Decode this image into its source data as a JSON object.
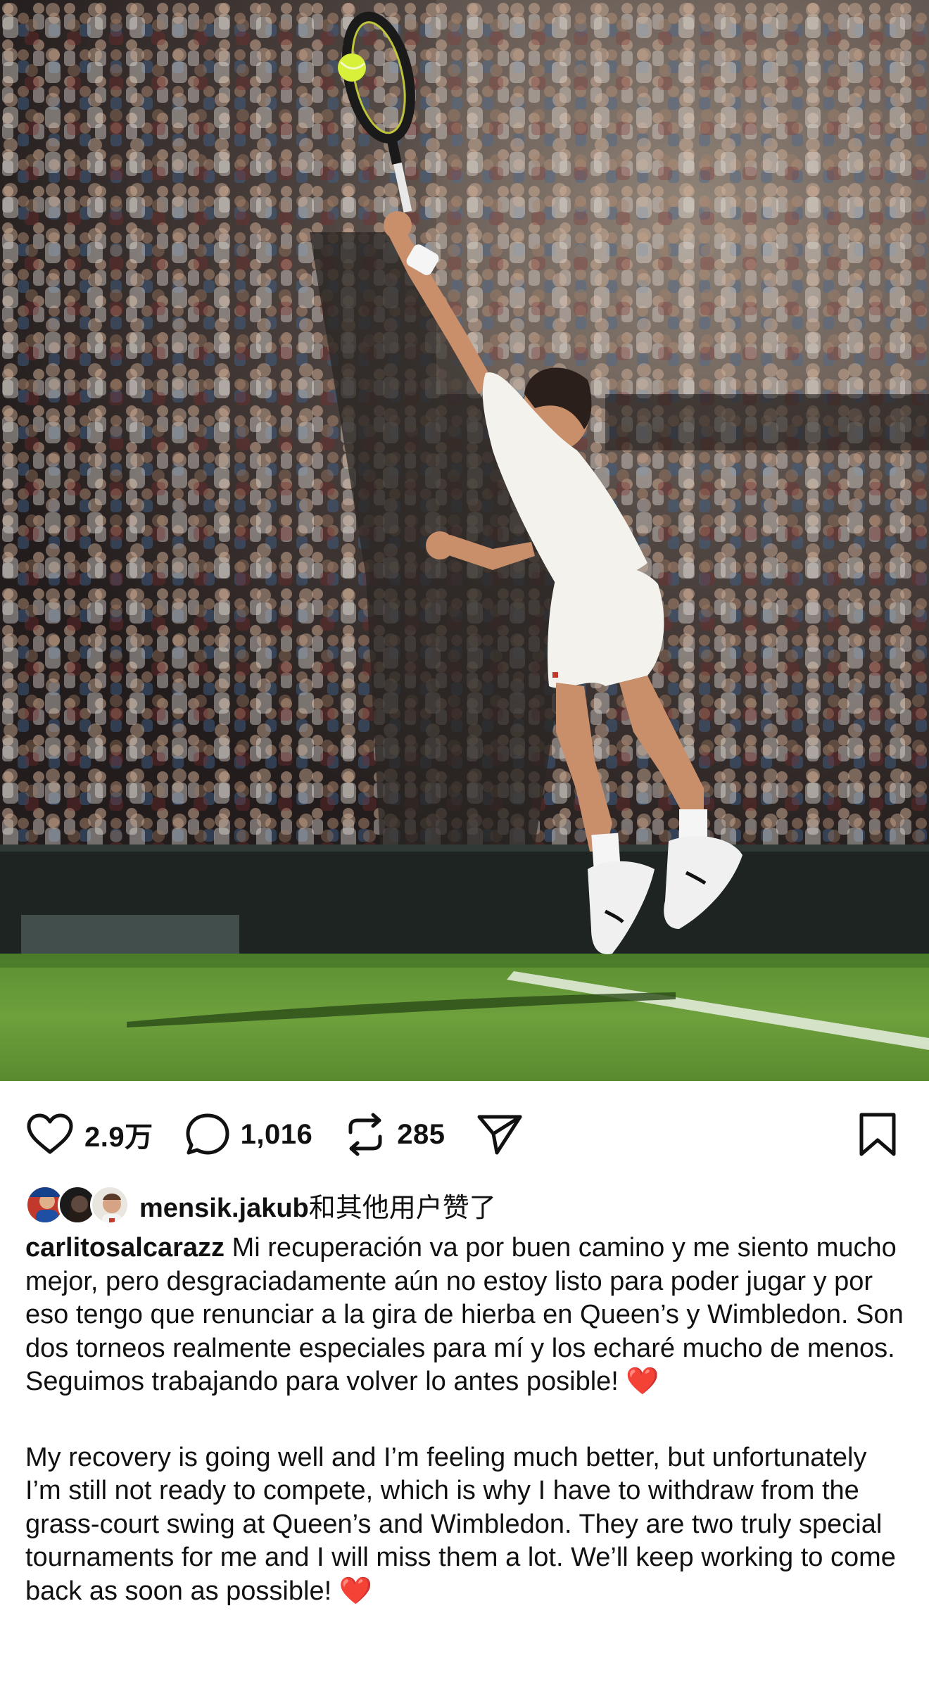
{
  "post": {
    "image_alt_icon": "tennis-player-photo"
  },
  "actions": {
    "likes": "2.9万",
    "comments": "1,016",
    "reposts": "285"
  },
  "liked_by": {
    "username": "mensik.jakub",
    "suffix": "和其他用户赞了"
  },
  "caption": {
    "username": "carlitosalcarazz",
    "spanish": "Mi recuperación va por buen camino y me siento mucho mejor, pero desgraciadamente aún no estoy listo para poder jugar y por eso tengo que renunciar a la gira de hierba en Queen’s y Wimbledon. Son dos torneos realmente especiales para mí y los echaré mucho de menos. Seguimos trabajando para volver lo antes posible!",
    "english": "My recovery is going well and I’m feeling much better, but unfortunately I’m still not ready to compete, which is why I have to withdraw from the grass-court swing at Queen’s and Wimbledon. They are two truly special tournaments for me and I will miss them a lot. We’ll keep working to come back as soon as possible!",
    "emoji": "❤️"
  },
  "colors": {
    "icon": "#111111",
    "heart_emoji": "#e0202f",
    "grass": "#4f8a2c"
  }
}
